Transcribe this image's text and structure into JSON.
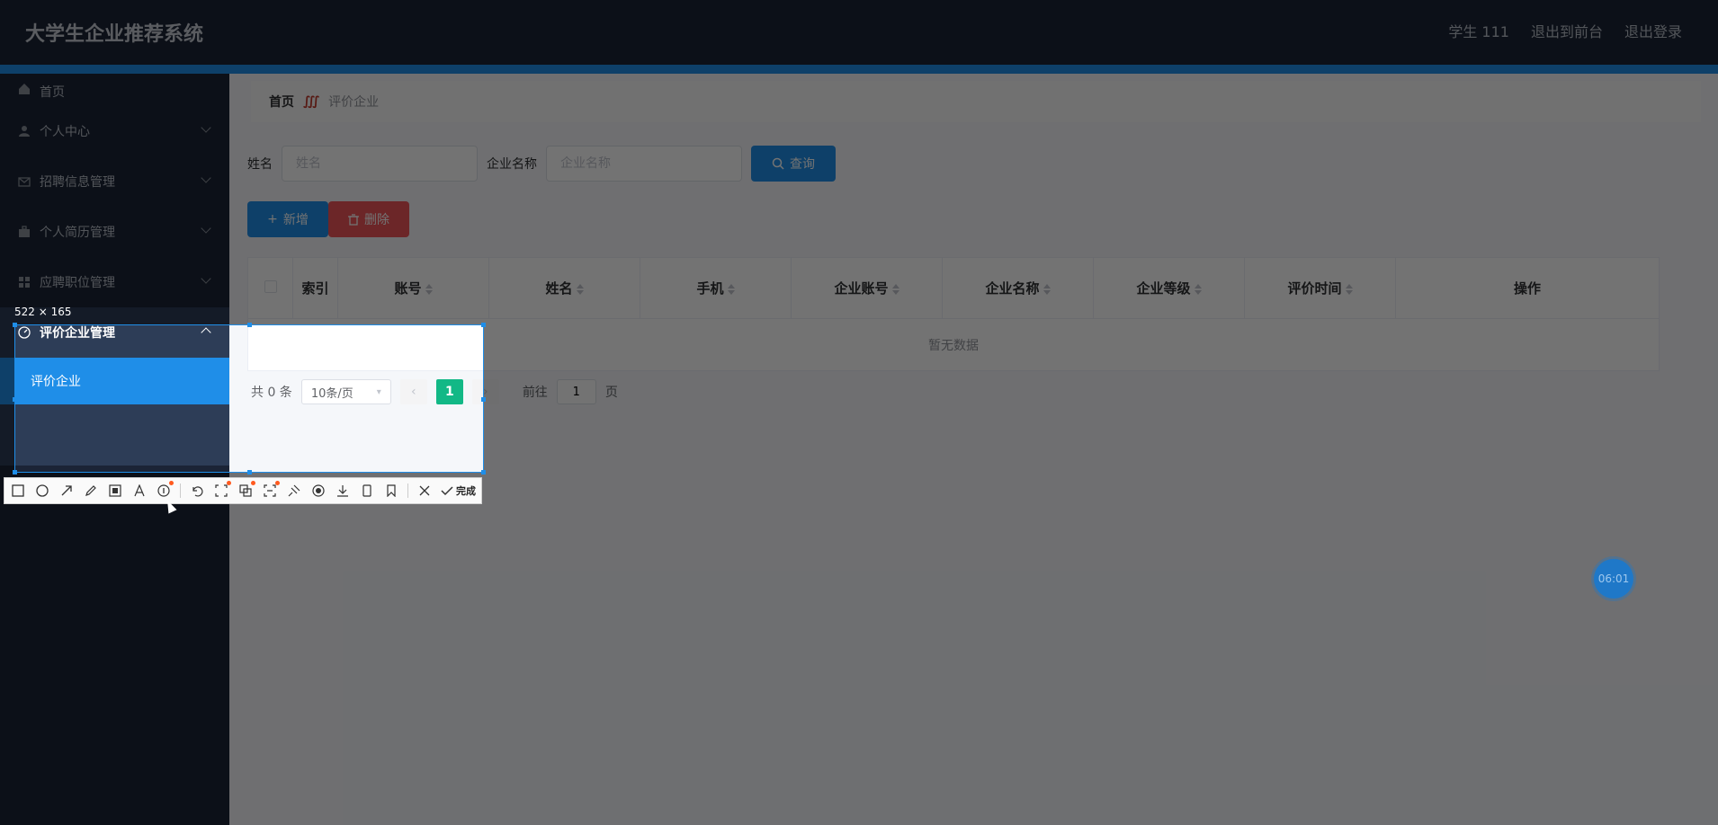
{
  "header": {
    "app_title": "大学生企业推荐系统",
    "user": "学生 111",
    "to_frontend": "退出到前台",
    "logout": "退出登录"
  },
  "sidebar": {
    "items": [
      {
        "label": "首页",
        "icon": "home-icon"
      },
      {
        "label": "个人中心",
        "icon": "user-icon"
      },
      {
        "label": "招聘信息管理",
        "icon": "mail-icon"
      },
      {
        "label": "个人简历管理",
        "icon": "briefcase-icon"
      },
      {
        "label": "应聘职位管理",
        "icon": "grid-icon"
      },
      {
        "label": "评价企业管理",
        "icon": "gauge-icon"
      }
    ],
    "sub_active": "评价企业"
  },
  "breadcrumb": {
    "home": "首页",
    "separator": "∭",
    "current": "评价企业"
  },
  "search": {
    "name_label": "姓名",
    "name_placeholder": "姓名",
    "company_label": "企业名称",
    "company_placeholder": "企业名称",
    "query_label": "查询"
  },
  "actions": {
    "add_label": "新增",
    "delete_label": "删除"
  },
  "table": {
    "index_header": "索引",
    "columns": [
      "账号",
      "姓名",
      "手机",
      "企业账号",
      "企业名称",
      "企业等级",
      "评价时间"
    ],
    "operation_header": "操作",
    "empty_text": "暂无数据"
  },
  "pagination": {
    "total_text": "共 0 条",
    "page_size": "10条/页",
    "current_page": "1",
    "goto_prefix": "前往",
    "goto_value": "1",
    "goto_suffix": "页"
  },
  "floating": {
    "time": "06:01"
  },
  "capture": {
    "size_label": "522 × 165",
    "done_label": "完成"
  },
  "colors": {
    "header_bg": "#1b2436",
    "accent": "#1f8ee8",
    "danger": "#f0555a",
    "page_active": "#12b886"
  }
}
